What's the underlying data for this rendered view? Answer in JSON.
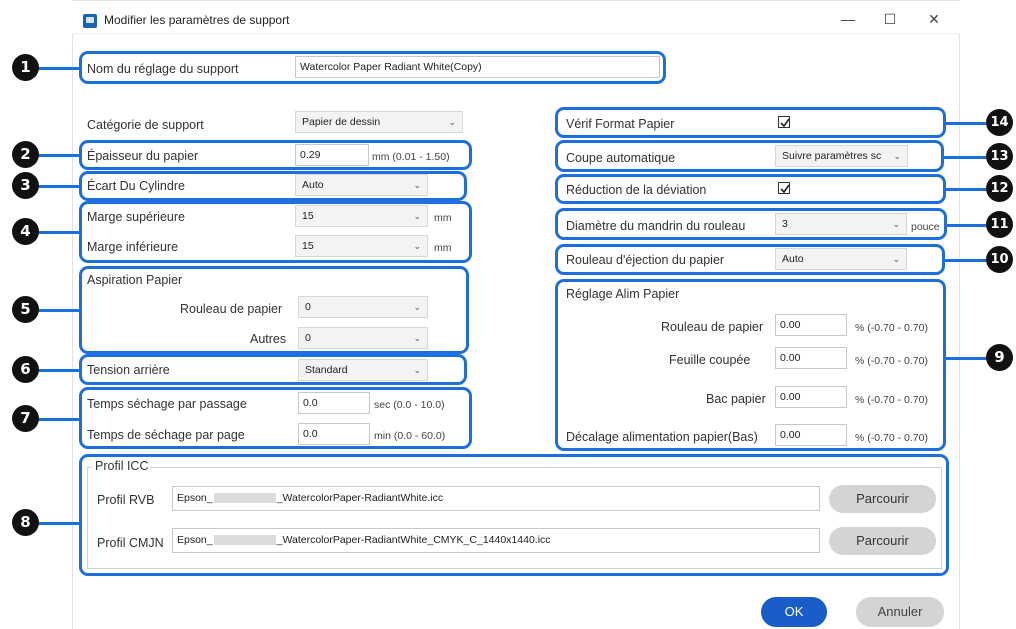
{
  "window": {
    "title": "Modifier les paramètres de support",
    "minimize": "—",
    "maximize": "☐",
    "close": "✕"
  },
  "media_name": {
    "label": "Nom du réglage du support",
    "value": "Watercolor Paper Radiant White(Copy)"
  },
  "media_category": {
    "label": "Catégorie de support",
    "value": "Papier de dessin"
  },
  "paper_thickness": {
    "label": "Épaisseur du papier",
    "value": "0.29",
    "unit": "mm (0.01 - 1.50)"
  },
  "platen_gap": {
    "label": "Écart Du Cylindre",
    "value": "Auto"
  },
  "top_margin": {
    "label": "Marge supérieure",
    "value": "15",
    "unit": "mm"
  },
  "bottom_margin": {
    "label": "Marge inférieure",
    "value": "15",
    "unit": "mm"
  },
  "paper_suction": {
    "title": "Aspiration Papier",
    "roll_label": "Rouleau de papier",
    "roll_value": "0",
    "other_label": "Autres",
    "other_value": "0"
  },
  "back_tension": {
    "label": "Tension arrière",
    "value": "Standard"
  },
  "drying_pass": {
    "label": "Temps séchage par passage",
    "value": "0.0",
    "unit": "sec (0.0 - 10.0)"
  },
  "drying_page": {
    "label": "Temps de séchage par page",
    "value": "0.0",
    "unit": "min (0.0 - 60.0)"
  },
  "icc": {
    "title": "Profil ICC",
    "rgb_label": "Profil RVB",
    "rgb_value_prefix": "Epson_",
    "rgb_value_suffix": "_WatercolorPaper-RadiantWhite.icc",
    "cmyk_label": "Profil CMJN",
    "cmyk_value_prefix": "Epson_",
    "cmyk_value_suffix": "_WatercolorPaper-RadiantWhite_CMYK_C_1440x1440.icc",
    "browse_label": "Parcourir"
  },
  "check_paper_size": {
    "label": "Vérif Format Papier",
    "checked": true
  },
  "auto_cut": {
    "label": "Coupe automatique",
    "value": "Suivre paramètres sc"
  },
  "skew_reduction": {
    "label": "Réduction de la déviation",
    "checked": true
  },
  "roll_core": {
    "label": "Diamètre du mandrin du rouleau",
    "value": "3",
    "unit": "pouce"
  },
  "eject_roller": {
    "label": "Rouleau d'éjection du papier",
    "value": "Auto"
  },
  "feed_adjust": {
    "title": "Réglage Alim Papier",
    "rows": [
      {
        "label": "Rouleau de papier",
        "value": "0.00",
        "unit": "% (-0.70 - 0.70)"
      },
      {
        "label": "Feuille coupée",
        "value": "0.00",
        "unit": "% (-0.70 - 0.70)"
      },
      {
        "label": "Bac papier",
        "value": "0.00",
        "unit": "% (-0.70 - 0.70)"
      },
      {
        "label": "Décalage alimentation papier(Bas)",
        "value": "0.00",
        "unit": "% (-0.70 - 0.70)"
      }
    ]
  },
  "buttons": {
    "ok": "OK",
    "cancel": "Annuler"
  },
  "callouts": [
    "1",
    "2",
    "3",
    "4",
    "5",
    "6",
    "7",
    "8",
    "9",
    "10",
    "11",
    "12",
    "13",
    "14"
  ],
  "colors": {
    "highlight": "#1d6fe0",
    "ok_button": "#1a5cc8",
    "callout": "#111111"
  }
}
